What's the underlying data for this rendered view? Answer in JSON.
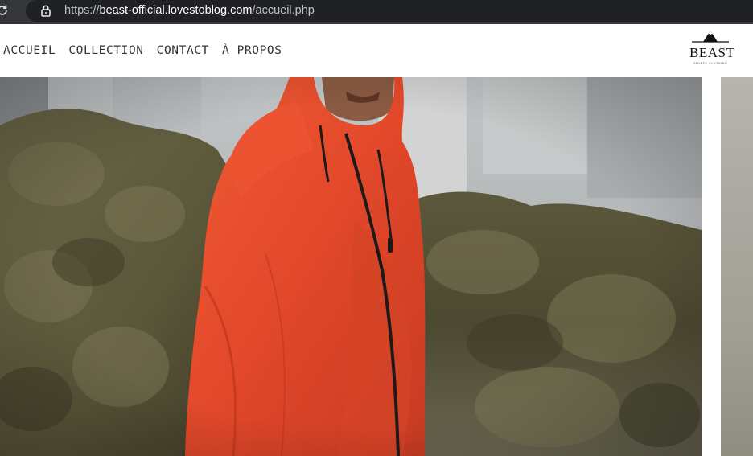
{
  "browser": {
    "url_prefix": "https://",
    "url_host": "beast-official.lovestoblog.com",
    "url_path": "/accueil.php",
    "icons": [
      "reload-icon",
      "lock-icon"
    ]
  },
  "nav": {
    "items": [
      {
        "label": "ACCUEIL"
      },
      {
        "label": "COLLECTION"
      },
      {
        "label": "CONTACT"
      },
      {
        "label": "À PROPOS"
      }
    ]
  },
  "logo": {
    "name": "BEAST",
    "tagline": "SPORTS CLOTHING",
    "icon": "mountain-icon"
  },
  "hero": {
    "subject": "person wearing orange hooded rain jacket in front of shrubs",
    "colors": {
      "jacket": "#e84e2c",
      "foliage": "#6b6647",
      "sky": "#c9ccce"
    }
  }
}
